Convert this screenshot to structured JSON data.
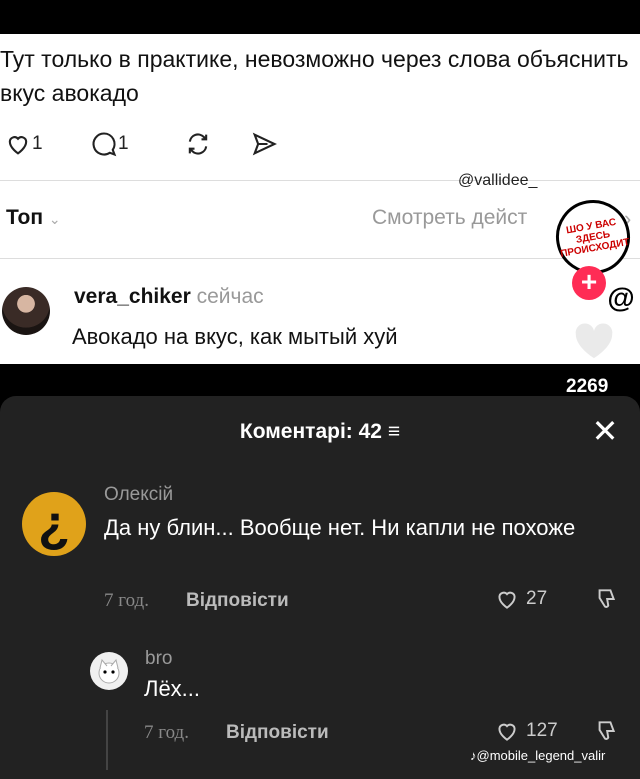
{
  "post": {
    "text": "Тут только в практике, невозможно через слова объяснить вкус авокадо",
    "like_count": "1",
    "reply_count": "1"
  },
  "watermark": "@vallidee_",
  "threads_bar": {
    "top_label": "Топ",
    "see_activity": "Смотреть дейст"
  },
  "reply": {
    "author": "vera_chiker",
    "time": "сейчас",
    "text": "Авокадо на вкус, как мытый хуй"
  },
  "sticker": {
    "text": "ШО У ВАС ЗДЕСЬ ПРОИСХОДИТ"
  },
  "video_likes": "2269",
  "comments_panel": {
    "title": "Коментарі: 42",
    "comment": {
      "author": "Олексій",
      "avatar_glyph": "¿",
      "text": "Да ну блин... Вообще нет. Ни капли не похоже",
      "time": "7 год.",
      "reply_label": "Відповісти",
      "likes": "27"
    },
    "subreply": {
      "author": "bro",
      "text": "Лёх...",
      "time": "7 год.",
      "reply_label": "Відповісти",
      "likes": "127"
    }
  },
  "tiktok_handle": "@mobile_legend_valir",
  "colors": {
    "accent": "#ff2c55",
    "avatar_yellow": "#e0a21a"
  }
}
